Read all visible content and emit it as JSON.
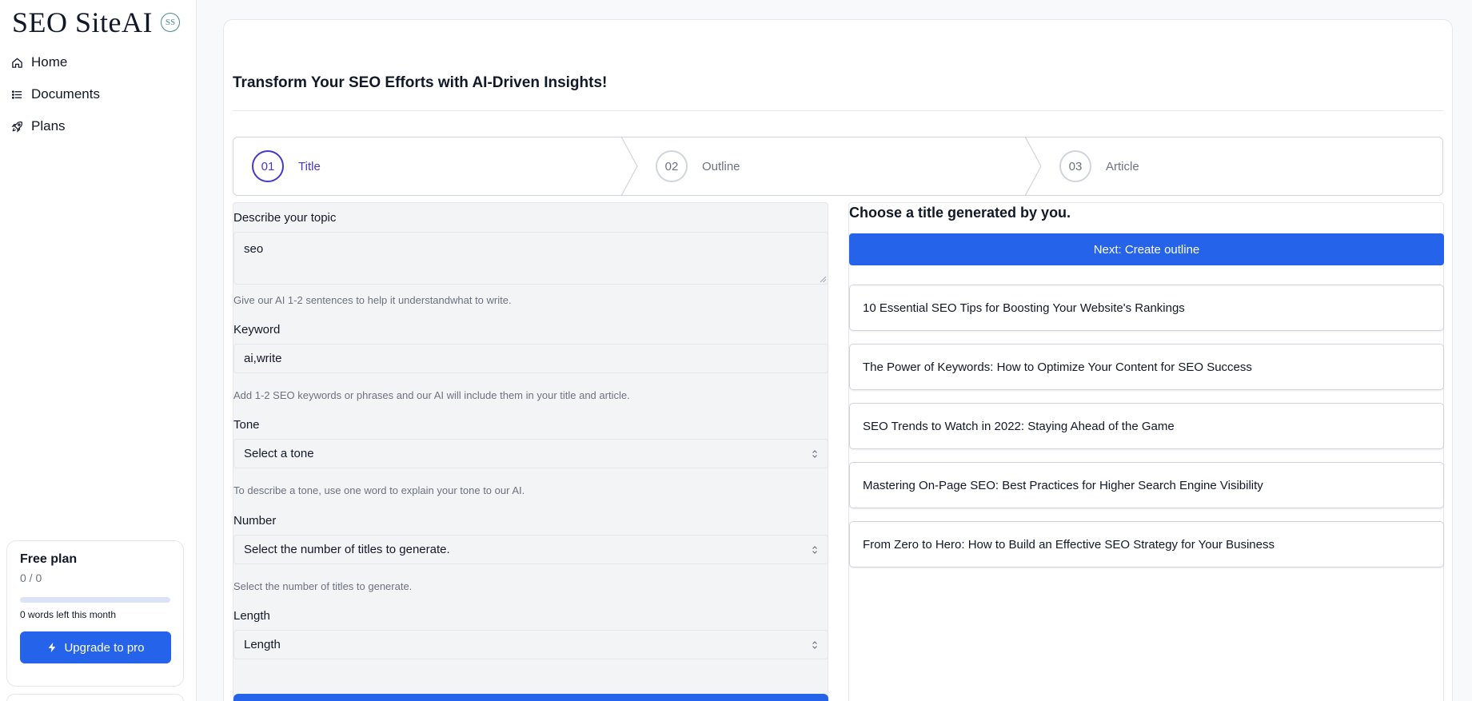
{
  "sidebar": {
    "brand": "SEO SiteAI",
    "badge": "SS",
    "nav": [
      {
        "label": "Home",
        "icon": "home-icon"
      },
      {
        "label": "Documents",
        "icon": "list-icon"
      },
      {
        "label": "Plans",
        "icon": "rocket-icon"
      }
    ],
    "plan": {
      "title": "Free plan",
      "count": "0 / 0",
      "usage_fraction": 0,
      "words_left": "0 words left this month",
      "upgrade_label": "Upgrade to pro"
    }
  },
  "main": {
    "heading": "Transform Your SEO Efforts with AI-Driven Insights!",
    "steps": [
      {
        "number": "01",
        "label": "Title",
        "active": true
      },
      {
        "number": "02",
        "label": "Outline",
        "active": false
      },
      {
        "number": "03",
        "label": "Article",
        "active": false
      }
    ],
    "form": {
      "topic": {
        "label": "Describe your topic",
        "value": "seo",
        "hint": "Give our AI 1-2 sentences to help it understandwhat to write."
      },
      "keyword": {
        "label": "Keyword",
        "value": "ai,write",
        "hint": "Add 1-2 SEO keywords or phrases and our AI will include them in your title and article."
      },
      "tone": {
        "label": "Tone",
        "selected": "Select a tone",
        "hint": "To describe a tone, use one word to explain your tone to our AI."
      },
      "number": {
        "label": "Number",
        "selected": "Select the number of titles to generate.",
        "hint": "Select the number of titles to generate."
      },
      "length": {
        "label": "Length",
        "selected": "Length"
      }
    },
    "results": {
      "title": "Choose a title generated by you.",
      "next_label": "Next: Create outline",
      "titles": [
        "10 Essential SEO Tips for Boosting Your Website's Rankings",
        "The Power of Keywords: How to Optimize Your Content for SEO Success",
        "SEO Trends to Watch in 2022: Staying Ahead of the Game",
        "Mastering On-Page SEO: Best Practices for Higher Search Engine Visibility",
        "From Zero to Hero: How to Build an Effective SEO Strategy for Your Business"
      ]
    }
  },
  "colors": {
    "accent": "#2563eb",
    "step_active": "#4338ca",
    "muted": "#6b7280"
  }
}
